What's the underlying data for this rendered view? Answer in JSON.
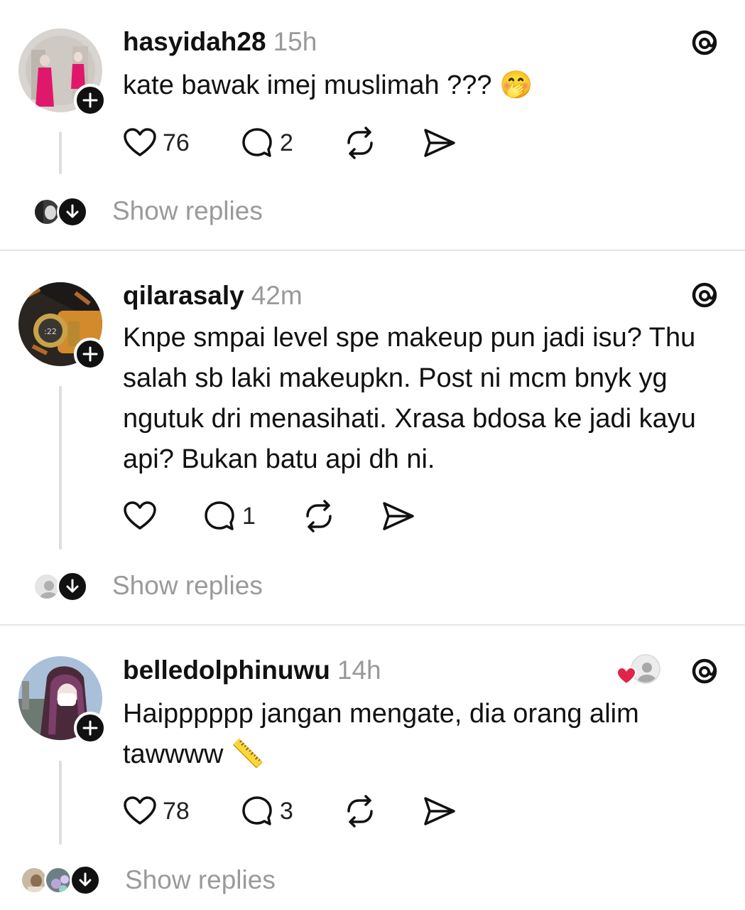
{
  "posts": [
    {
      "username": "hasyidah28",
      "time": "15h",
      "text": "kate bawak imej muslimah ???",
      "emoji": "🤭",
      "likes": "76",
      "replies": "2",
      "show_replies": "Show replies"
    },
    {
      "username": "qilarasaly",
      "time": "42m",
      "text": "Knpe smpai level spe makeup pun jadi isu? Thu salah sb laki makeupkn. Post ni mcm bnyk yg ngutuk dri menasihati. Xrasa bdosa ke jadi kayu api? Bukan batu api dh ni.",
      "likes": "",
      "replies": "1",
      "show_replies": "Show replies"
    },
    {
      "username": "belledolphinuwu",
      "time": "14h",
      "text": "Haipppppp jangan mengate, dia orang alim tawwww",
      "emoji": "📏",
      "likes": "78",
      "replies": "3",
      "show_replies": "Show replies"
    }
  ],
  "icons": [
    "threads-icon",
    "heart-icon",
    "comment-icon",
    "repost-icon",
    "share-icon",
    "follow-plus-icon",
    "arrow-down-icon"
  ],
  "colors": {
    "text": "#111111",
    "muted": "#999999",
    "divider": "#e6e6e6",
    "liked_heart": "#e0245e"
  }
}
